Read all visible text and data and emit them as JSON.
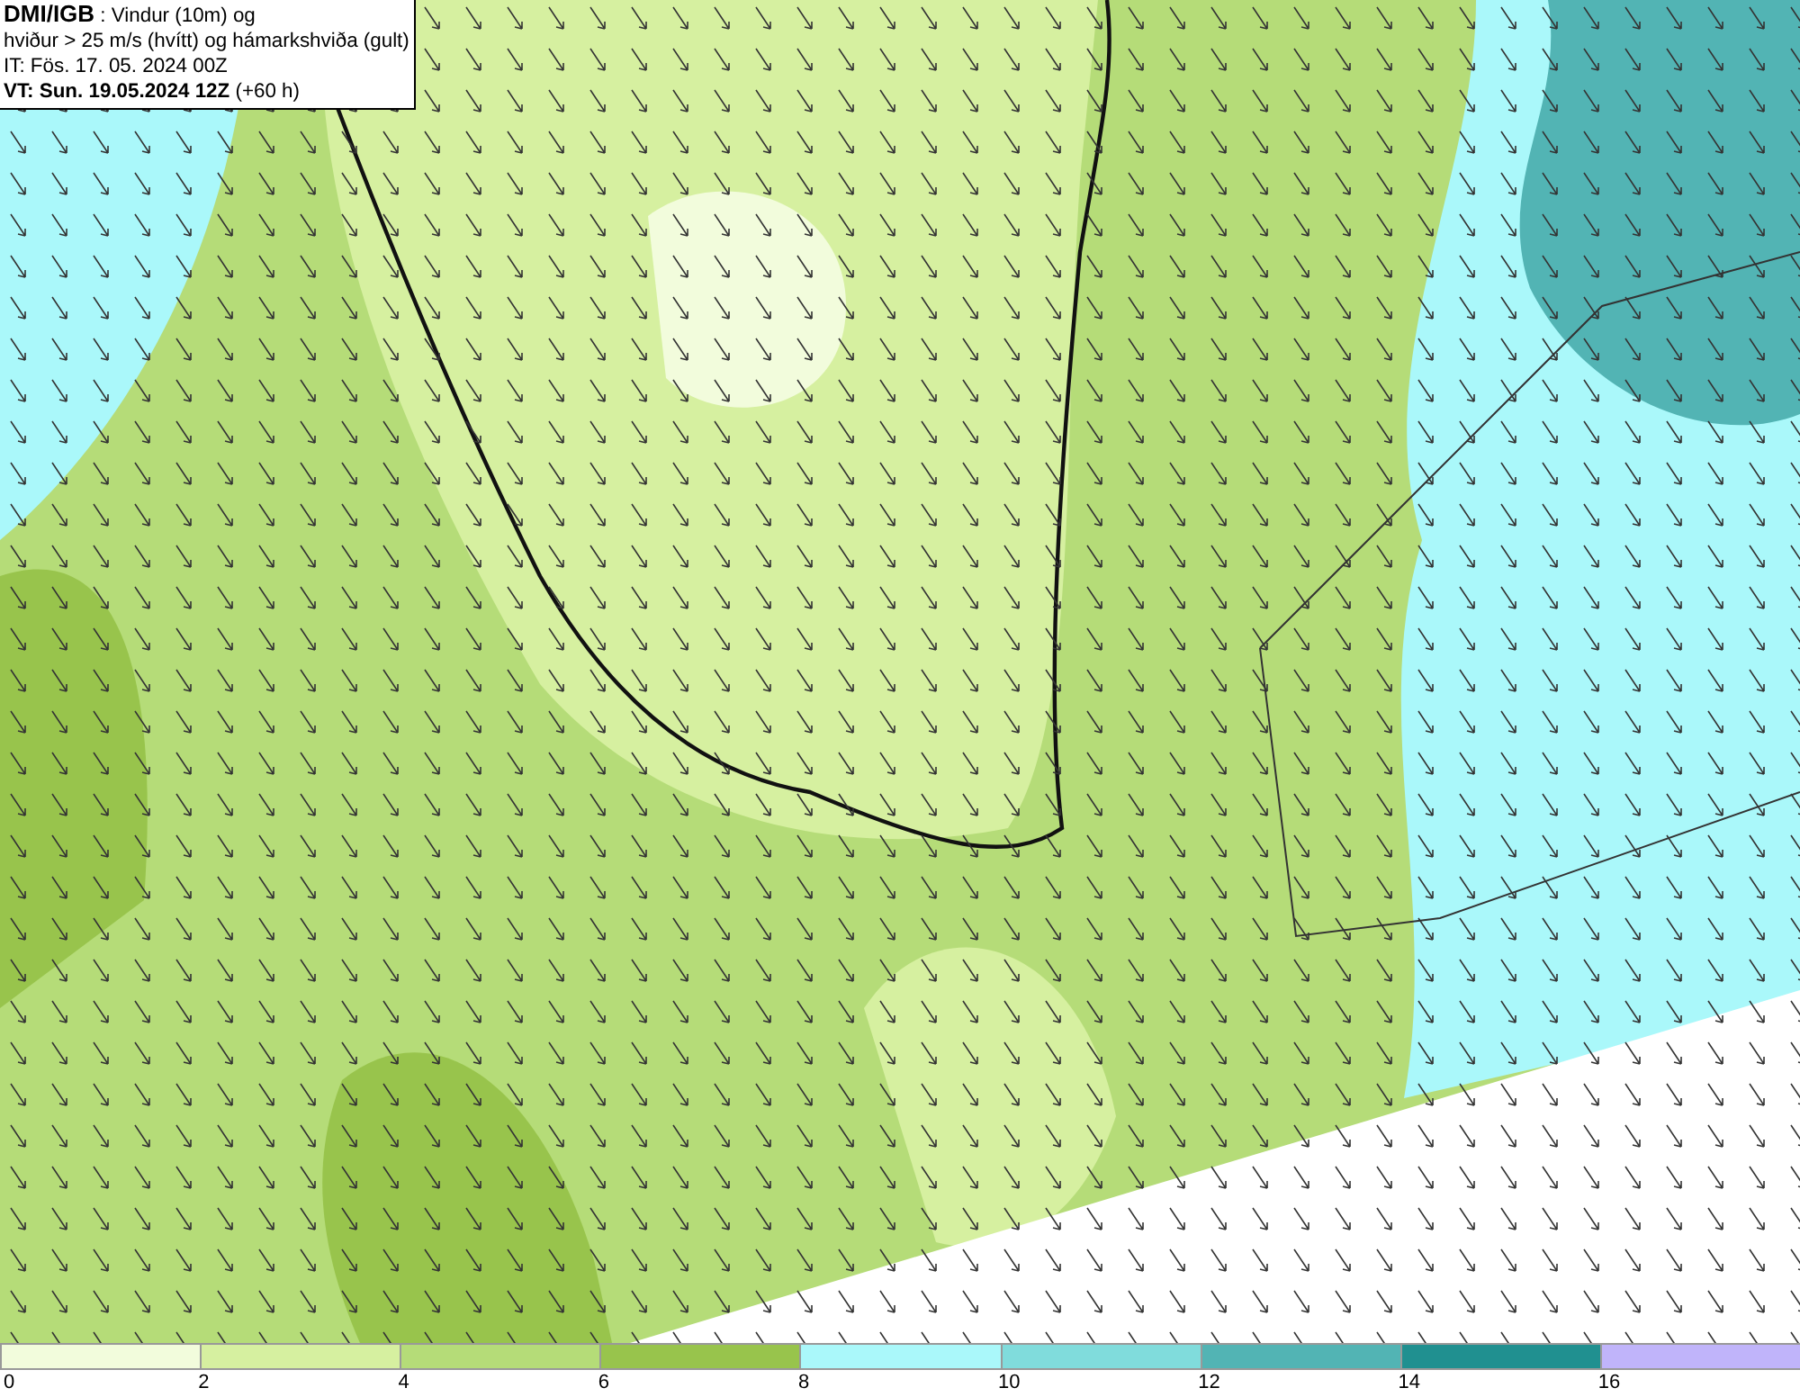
{
  "header": {
    "lines": [
      "**DMI/IGB** : Vindur (10m) og",
      "hviður > 25 m/s (hvítt) og hámarkshviða (gult)",
      "IT: Fös. 17. 05. 2024 00Z",
      "**VT: Sun. 19.05.2024 12Z** (+60 h)"
    ]
  },
  "legend": {
    "bins": [
      {
        "label": "0",
        "color": "#f2fcdc"
      },
      {
        "label": "2",
        "color": "#d6f0a0"
      },
      {
        "label": "4",
        "color": "#b5dc78"
      },
      {
        "label": "6",
        "color": "#98c44c"
      },
      {
        "label": "8",
        "color": "#aaf8fa"
      },
      {
        "label": "10",
        "color": "#80dcdc"
      },
      {
        "label": "12",
        "color": "#52b4b4"
      },
      {
        "label": "14",
        "color": "#209090"
      },
      {
        "label": "16",
        "color": "#c0b4fa"
      }
    ]
  }
}
